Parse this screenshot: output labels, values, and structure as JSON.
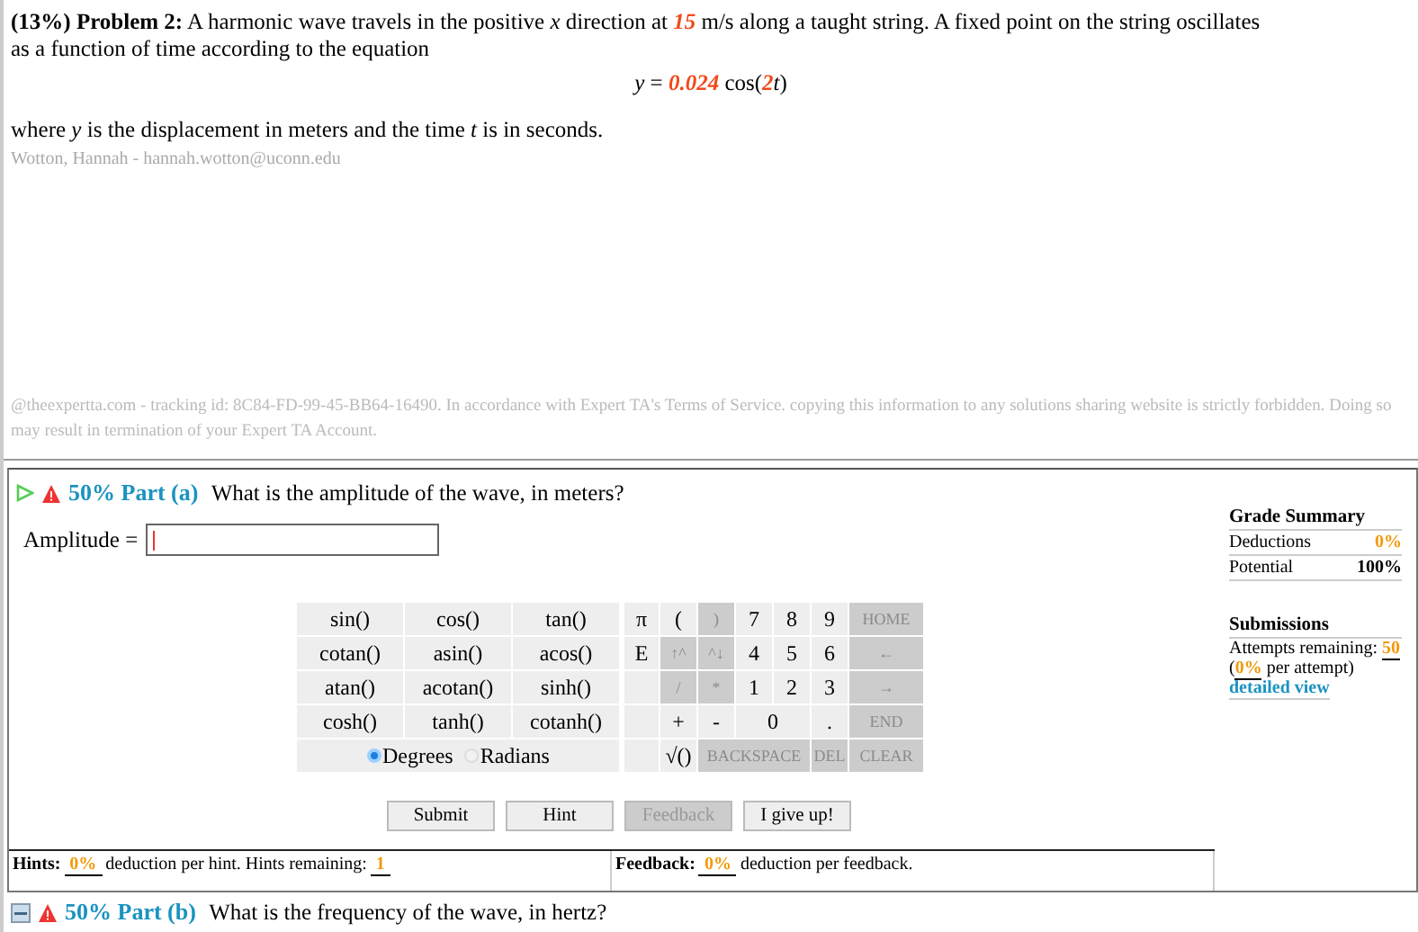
{
  "problem": {
    "weight": "(13%)",
    "title": "Problem 2:",
    "intro": [
      {
        "text": "A harmonic wave travels in the positive *x* direction at ",
        "highlight": false
      },
      {
        "text": "15",
        "highlight": true
      },
      {
        "text": " m/s along a taught string. A fixed point on the string oscillates as a function of time according to the equation",
        "highlight": false
      }
    ],
    "equation": [
      {
        "text": "*y* = ",
        "highlight": false
      },
      {
        "text": "0.024",
        "highlight": true
      },
      {
        "text": " cos(",
        "highlight": false
      },
      {
        "text": "2",
        "highlight": true
      },
      {
        "text": "*t*)",
        "highlight": false
      }
    ],
    "after": "where *y* is the displacement in meters and the time *t* is in seconds.",
    "author": "Wotton, Hannah - hannah.wotton@uconn.edu",
    "notice": "@theexpertta.com - tracking id: 8C84-FD-99-45-BB64-16490. In accordance with Expert TA's Terms of Service. copying this information to any solutions sharing website is strictly forbidden. Doing so may result in termination of your Expert TA Account."
  },
  "part_a": {
    "expanded": true,
    "weight": "50%",
    "label": "Part (a)",
    "question": "What is the amplitude of the wave, in meters?",
    "answer_label": "Amplitude =",
    "functions": [
      "sin()",
      "cos()",
      "tan()",
      "cotan()",
      "asin()",
      "acos()",
      "atan()",
      "acotan()",
      "sinh()",
      "cosh()",
      "tanh()",
      "cotanh()"
    ],
    "angle_modes": [
      {
        "label": "Degrees",
        "selected": true
      },
      {
        "label": "Radians",
        "selected": false
      }
    ],
    "keys": [
      [
        {
          "kind": "key",
          "label": "π",
          "disabled": false
        },
        {
          "kind": "key",
          "label": "(",
          "disabled": false
        },
        {
          "kind": "key",
          "label": ")",
          "disabled": true
        },
        {
          "kind": "key",
          "label": "7",
          "disabled": false
        },
        {
          "kind": "key",
          "label": "8",
          "disabled": false
        },
        {
          "kind": "key",
          "label": "9",
          "disabled": false
        },
        {
          "kind": "key",
          "label": "HOME",
          "disabled": true
        }
      ],
      [
        {
          "kind": "key",
          "label": "E",
          "disabled": false
        },
        {
          "kind": "key",
          "label": "↑^",
          "disabled": true
        },
        {
          "kind": "key",
          "label": "^↓",
          "disabled": true
        },
        {
          "kind": "key",
          "label": "4",
          "disabled": false
        },
        {
          "kind": "key",
          "label": "5",
          "disabled": false
        },
        {
          "kind": "key",
          "label": "6",
          "disabled": false
        },
        {
          "kind": "key",
          "label": "←",
          "disabled": true
        }
      ],
      [
        {
          "kind": "blank"
        },
        {
          "kind": "key",
          "label": "/",
          "disabled": true
        },
        {
          "kind": "key",
          "label": "*",
          "disabled": true
        },
        {
          "kind": "key",
          "label": "1",
          "disabled": false
        },
        {
          "kind": "key",
          "label": "2",
          "disabled": false
        },
        {
          "kind": "key",
          "label": "3",
          "disabled": false
        },
        {
          "kind": "key",
          "label": "→",
          "disabled": true
        }
      ],
      [
        {
          "kind": "blank"
        },
        {
          "kind": "key",
          "label": "+",
          "disabled": false
        },
        {
          "kind": "key",
          "label": "-",
          "disabled": false
        },
        {
          "kind": "key",
          "label": "0",
          "disabled": false
        },
        {
          "kind": "key",
          "label": ".",
          "disabled": false
        },
        {
          "kind": "key",
          "label": "END",
          "disabled": true
        }
      ],
      [
        {
          "kind": "blank"
        },
        {
          "kind": "key",
          "label": "√()",
          "disabled": false
        },
        {
          "kind": "key",
          "label": "BACKSPACE",
          "disabled": true
        },
        {
          "kind": "key",
          "label": "DEL",
          "disabled": true
        },
        {
          "kind": "key",
          "label": "CLEAR",
          "disabled": true
        }
      ]
    ],
    "actions": [
      {
        "label": "Submit",
        "disabled": false
      },
      {
        "label": "Hint",
        "disabled": false
      },
      {
        "label": "Feedback",
        "disabled": true
      },
      {
        "label": "I give up!",
        "disabled": false
      }
    ],
    "hints": {
      "label": "Hints:",
      "value": "0%",
      "text": "deduction per hint. Hints remaining:",
      "remaining": "1"
    },
    "feedback": {
      "label": "Feedback:",
      "value": "0%",
      "text": "deduction per feedback."
    },
    "grade_summary": {
      "title": "Grade Summary",
      "rows": [
        {
          "label": "Deductions",
          "value": "0%",
          "highlight": true
        },
        {
          "label": "Potential",
          "value": "100%",
          "highlight": false
        }
      ]
    },
    "submissions": {
      "title": "Submissions",
      "attempts_label": "Attempts remaining:",
      "attempts": "50",
      "per_open": "(",
      "per_value": "0%",
      "per_text": "per attempt)",
      "link": "detailed view"
    }
  },
  "part_b": {
    "expanded": false,
    "weight": "50%",
    "label": "Part (b)",
    "question": "What is the frequency of the wave, in hertz?"
  }
}
